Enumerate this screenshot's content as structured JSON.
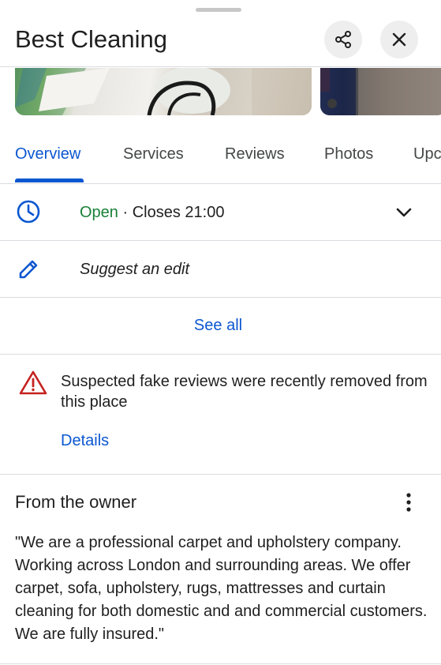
{
  "place": {
    "name": "Best Cleaning"
  },
  "tabs": [
    {
      "label": "Overview",
      "active": true
    },
    {
      "label": "Services",
      "active": false
    },
    {
      "label": "Reviews",
      "active": false
    },
    {
      "label": "Photos",
      "active": false
    },
    {
      "label": "Upc",
      "active": false
    }
  ],
  "hours": {
    "status": "Open",
    "separator": " · ",
    "closes": "Closes 21:00"
  },
  "suggest_edit": {
    "label": "Suggest an edit"
  },
  "see_all": {
    "label": "See all"
  },
  "notice": {
    "text": "Suspected fake reviews were recently removed from this place",
    "link": "Details"
  },
  "owner": {
    "heading": "From the owner",
    "description": "\"We are a professional carpet and upholstery company. Working across London and surrounding areas. We offer carpet, sofa, upholstery, rugs, mattresses and curtain cleaning for both domestic and and commercial customers. We are fully insured.\""
  },
  "icons": {
    "share": "share-icon",
    "close": "close-icon",
    "clock": "clock-icon",
    "expand": "chevron-down-icon",
    "edit": "pencil-icon",
    "warning": "warning-icon",
    "more": "more-vert-icon"
  },
  "colors": {
    "accent": "#0b57d0",
    "open": "#188038",
    "warning": "#c5221f",
    "divider": "#dadce0"
  }
}
